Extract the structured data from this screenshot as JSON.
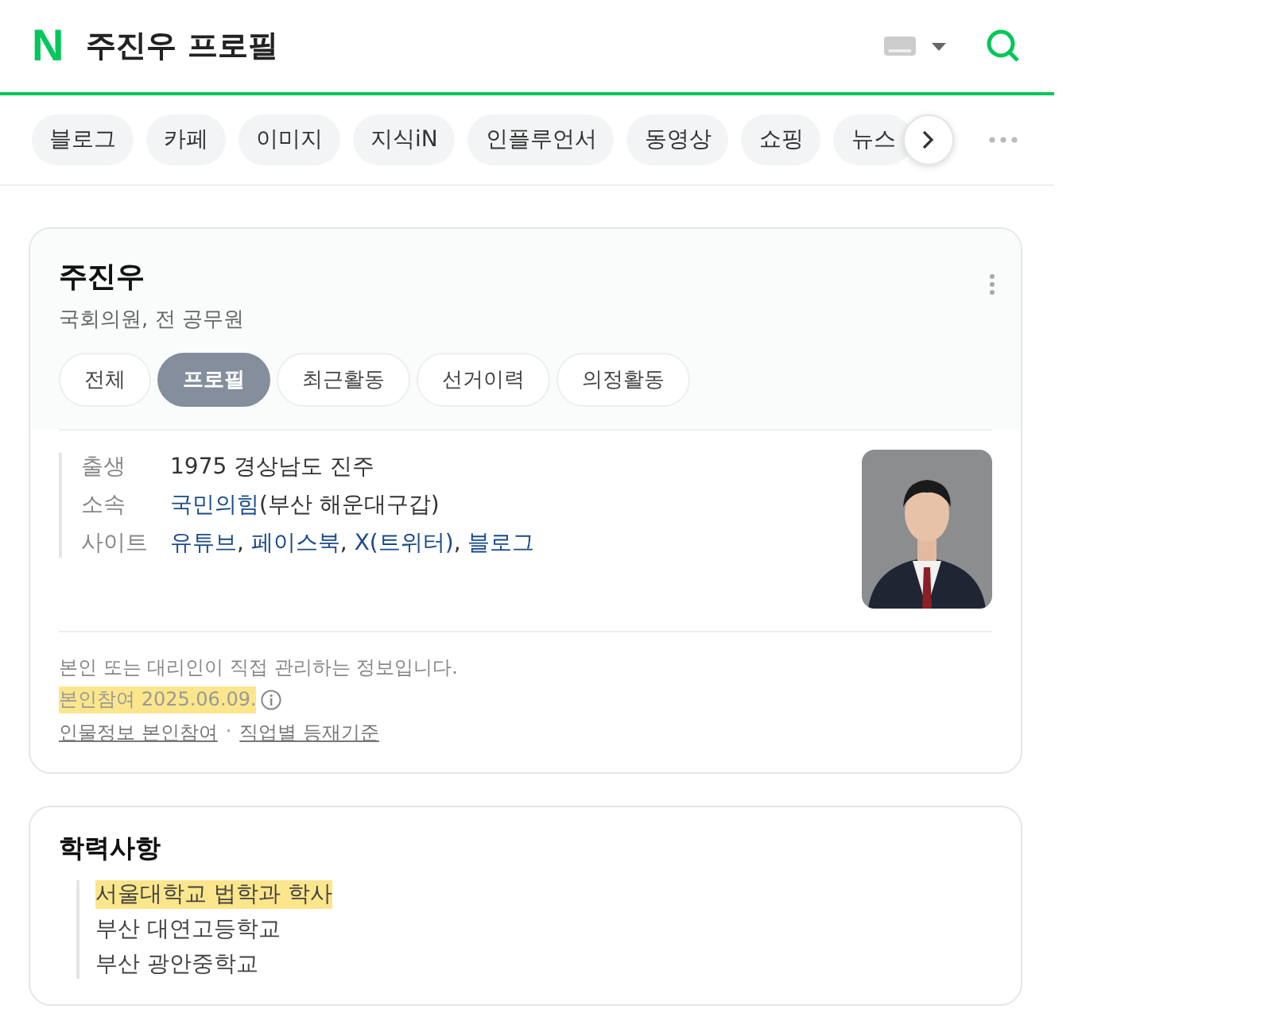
{
  "header": {
    "logo": "N",
    "query": "주진우 프로필"
  },
  "categories": [
    {
      "label": "블로그"
    },
    {
      "label": "카페"
    },
    {
      "label": "이미지"
    },
    {
      "label": "지식iN"
    },
    {
      "label": "인플루언서"
    },
    {
      "label": "동영상"
    },
    {
      "label": "쇼핑"
    },
    {
      "label": "뉴스"
    }
  ],
  "profile": {
    "name": "주진우",
    "subtitle": "국회의원, 전 공무원",
    "tabs": [
      {
        "label": "전체",
        "selected": false
      },
      {
        "label": "프로필",
        "selected": true
      },
      {
        "label": "최근활동",
        "selected": false
      },
      {
        "label": "선거이력",
        "selected": false
      },
      {
        "label": "의정활동",
        "selected": false
      }
    ],
    "info": [
      {
        "kind": "text",
        "label": "출생",
        "value": "1975 경상남도 진주"
      },
      {
        "kind": "affiliation",
        "label": "소속",
        "link": "국민의힘",
        "rest": "(부산 해운대구갑)"
      },
      {
        "kind": "links",
        "label": "사이트",
        "separator": ",",
        "links": [
          "유튜브",
          "페이스북",
          "X(트위터)",
          "블로그"
        ]
      }
    ],
    "notice": "본인 또는 대리인이 직접 관리하는 정보입니다.",
    "participation": {
      "text": "본인참여 2025.06.09.",
      "highlighted": true
    },
    "footer_links": [
      "인물정보 본인참여",
      "직업별 등재기준"
    ],
    "footer_separator": "·"
  },
  "education": {
    "title": "학력사항",
    "items": [
      {
        "text": "서울대학교 법학과 학사",
        "highlighted": true
      },
      {
        "text": "부산 대연고등학교",
        "highlighted": false
      },
      {
        "text": "부산 광안중학교",
        "highlighted": false
      }
    ]
  }
}
